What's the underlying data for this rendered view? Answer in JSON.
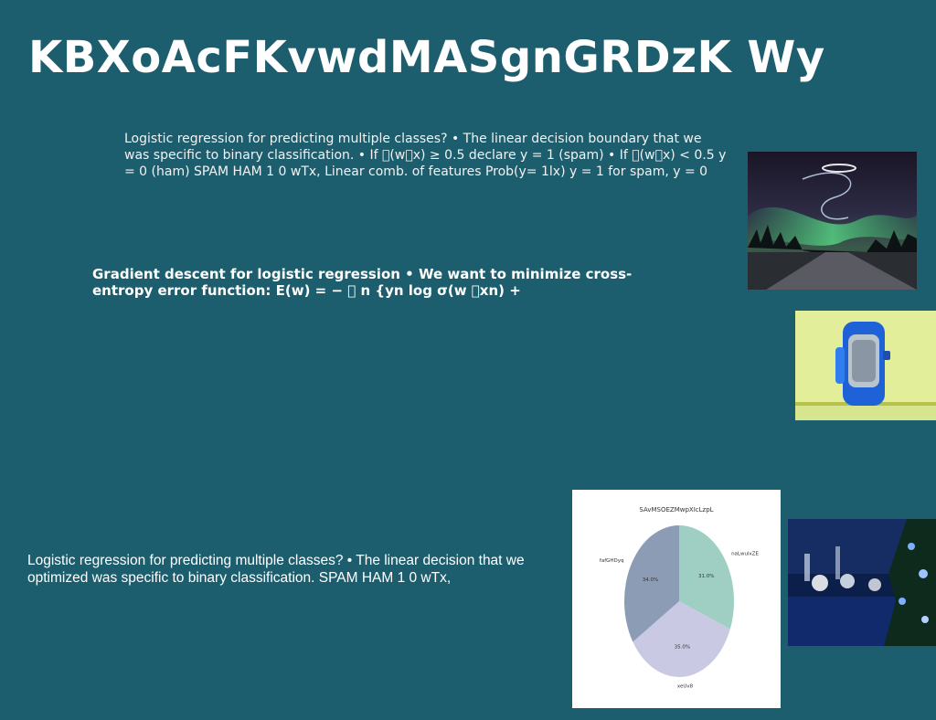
{
  "slide": {
    "title": "KBXoAcFKvwdMASgnGRDzK Wy",
    "paragraph_1": "Logistic regression for predicting multiple classes? • The linear decision boundary that we was specific to binary classification. • If \u0000(w\u0000x) ≥ 0.5 declare y = 1 (spam) • If \u0000(w\u0000x) < 0.5 y = 0 (ham) SPAM HAM 1 0 wTx, Linear comb. of features Prob(y= 1lx) y = 1 for spam, y = 0",
    "paragraph_2": "Gradient descent for logistic regression • We want to minimize cross-entropy error function: E(w) = − \u0000 n {yn log σ(w \u0000xn) +",
    "paragraph_3": "Logistic regression for predicting multiple classes? • The linear decision that we optimized was specific to binary classification. SPAM HAM 1 0 wTx,"
  },
  "images": {
    "aurora": "aurora-night-road-photo",
    "watch": "blue-wristwatch-photo",
    "table": "blue-christmas-table-photo"
  },
  "chart_data": {
    "type": "pie",
    "title": "SAvMSOEZMwpXIcLzpL",
    "series": [
      {
        "label": "naLwulxZE",
        "value": 31.0,
        "pct_label": "31.0%",
        "color": "#9fcfc2"
      },
      {
        "label": "xeUv8",
        "value": 35.0,
        "pct_label": "35.0%",
        "color": "#c9c9e3"
      },
      {
        "label": "fafGHDyq",
        "value": 34.0,
        "pct_label": "34.0%",
        "color": "#8c9cb5"
      }
    ],
    "start_angle": "top, clockwise",
    "legend": "none"
  }
}
